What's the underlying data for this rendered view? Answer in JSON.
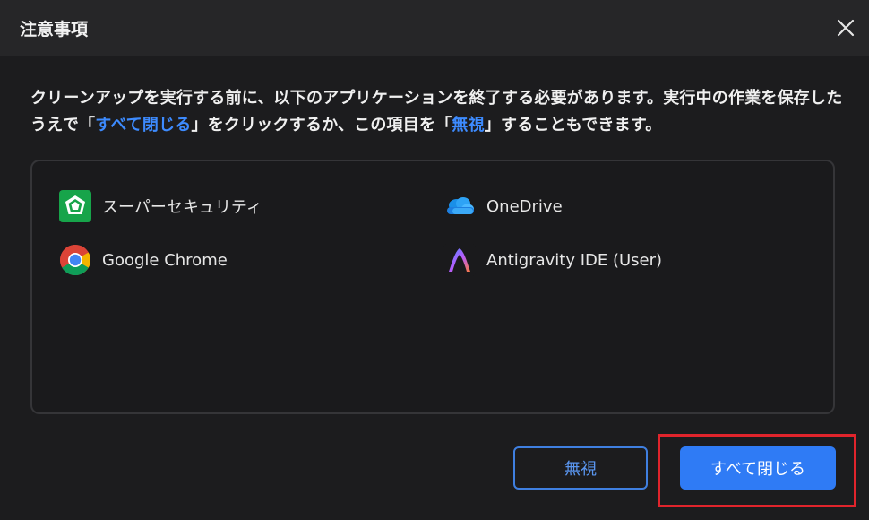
{
  "dialog": {
    "title": "注意事項",
    "close_icon": "close-icon"
  },
  "message": {
    "part1": "クリーンアップを実行する前に、以下のアプリケーションを終了する必要があります。実行中の作業を保存したうえで「",
    "highlight1": "すべて閉じる",
    "part2": "」をクリックするか、この項目を「",
    "highlight2": "無視",
    "part3": "」することもできます。"
  },
  "apps": [
    {
      "label": "スーパーセキュリティ",
      "icon": "super-security-icon"
    },
    {
      "label": "OneDrive",
      "icon": "onedrive-icon"
    },
    {
      "label": "Google Chrome",
      "icon": "chrome-icon"
    },
    {
      "label": "Antigravity IDE (User)",
      "icon": "antigravity-icon"
    }
  ],
  "buttons": {
    "ignore_label": "無視",
    "close_all_label": "すべて閉じる"
  },
  "colors": {
    "accent": "#2f7bf5",
    "highlight_text": "#3d8bff",
    "annotation_frame": "#e0242c"
  }
}
